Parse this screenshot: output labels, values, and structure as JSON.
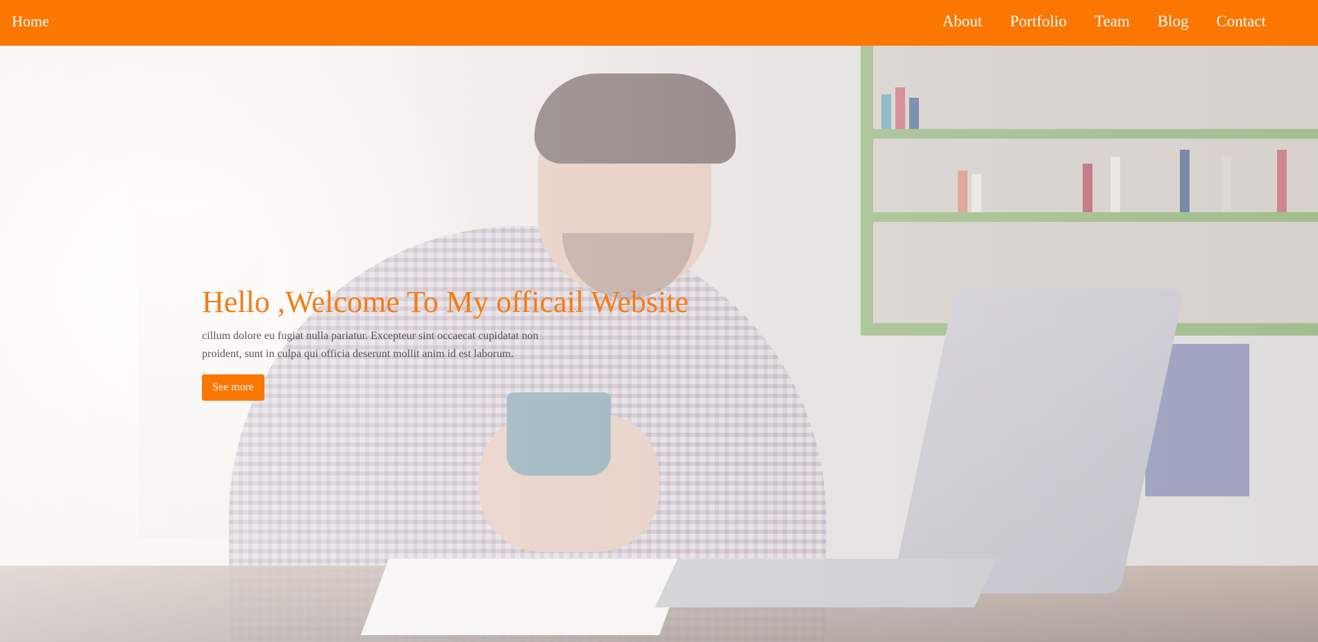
{
  "nav": {
    "home_label": "Home",
    "links": [
      {
        "label": "About"
      },
      {
        "label": "Portfolio"
      },
      {
        "label": "Team"
      },
      {
        "label": "Blog"
      },
      {
        "label": "Contact"
      }
    ]
  },
  "hero": {
    "title": "Hello ,Welcome To My officail Website",
    "text": "cillum dolore eu fugiat nulla pariatur. Excepteur sint occaecat cupidatat non proident, sunt in culpa qui officia deserunt mollit anim id est laborum.",
    "button_label": "See more",
    "background_image": "person-at-laptop-holding-mug-photo"
  },
  "colors": {
    "accent": "#fb7701",
    "title": "#f47c14",
    "nav_text": "#ffffff",
    "body_text": "#5a5654"
  }
}
